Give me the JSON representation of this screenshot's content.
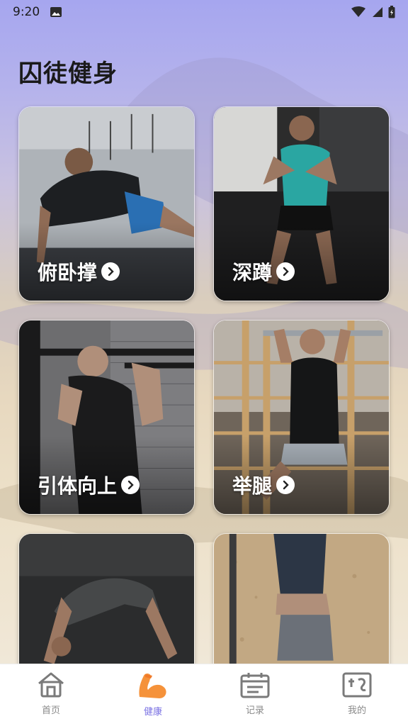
{
  "status_bar": {
    "time": "9:20"
  },
  "page": {
    "title": "囚徒健身"
  },
  "exercises": [
    {
      "label": "俯卧撑",
      "photo_desc": "push-up"
    },
    {
      "label": "深蹲",
      "photo_desc": "squat"
    },
    {
      "label": "引体向上",
      "photo_desc": "pull-up"
    },
    {
      "label": "举腿",
      "photo_desc": "leg-raise"
    },
    {
      "label": "",
      "photo_desc": "bridge"
    },
    {
      "label": "",
      "photo_desc": "handstand"
    }
  ],
  "tabbar": {
    "items": [
      {
        "label": "首页",
        "icon": "home-icon",
        "active": false
      },
      {
        "label": "健康",
        "icon": "flexed-arm-icon",
        "active": true
      },
      {
        "label": "记录",
        "icon": "calendar-icon",
        "active": false
      },
      {
        "label": "我的",
        "icon": "profile-icon",
        "active": false
      }
    ]
  },
  "colors": {
    "accent": "#7b72e3",
    "active_icon": "#f5923a"
  }
}
